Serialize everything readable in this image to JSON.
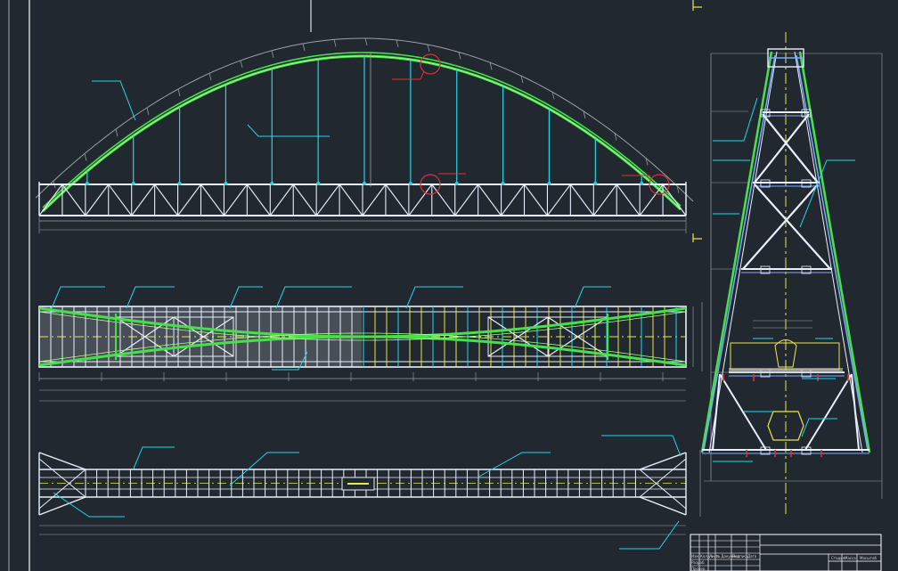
{
  "title_block": {
    "col_labels": [
      "Изм.",
      "Кол.уч",
      "Лист",
      "№ Документ",
      "Подпись",
      "Дата"
    ],
    "row_labels": [
      "Разраб.",
      "Провер.",
      "Т.контр.",
      "Н.контр.",
      "Утв."
    ],
    "sheet_labels": [
      "Стадия",
      "Масса",
      "Масштаб"
    ]
  },
  "colors": {
    "background": "#212830",
    "frame": "#ffffff",
    "arch": "#46e04a",
    "hanger": "#22d6e8",
    "truss": "#e8f0ff",
    "truss_alt": "#7aa8ff",
    "centerline": "#e8e84a",
    "dimension": "#9aa0a6",
    "callout_circle": "#e03030",
    "section_fill": "#c8c8c8"
  }
}
